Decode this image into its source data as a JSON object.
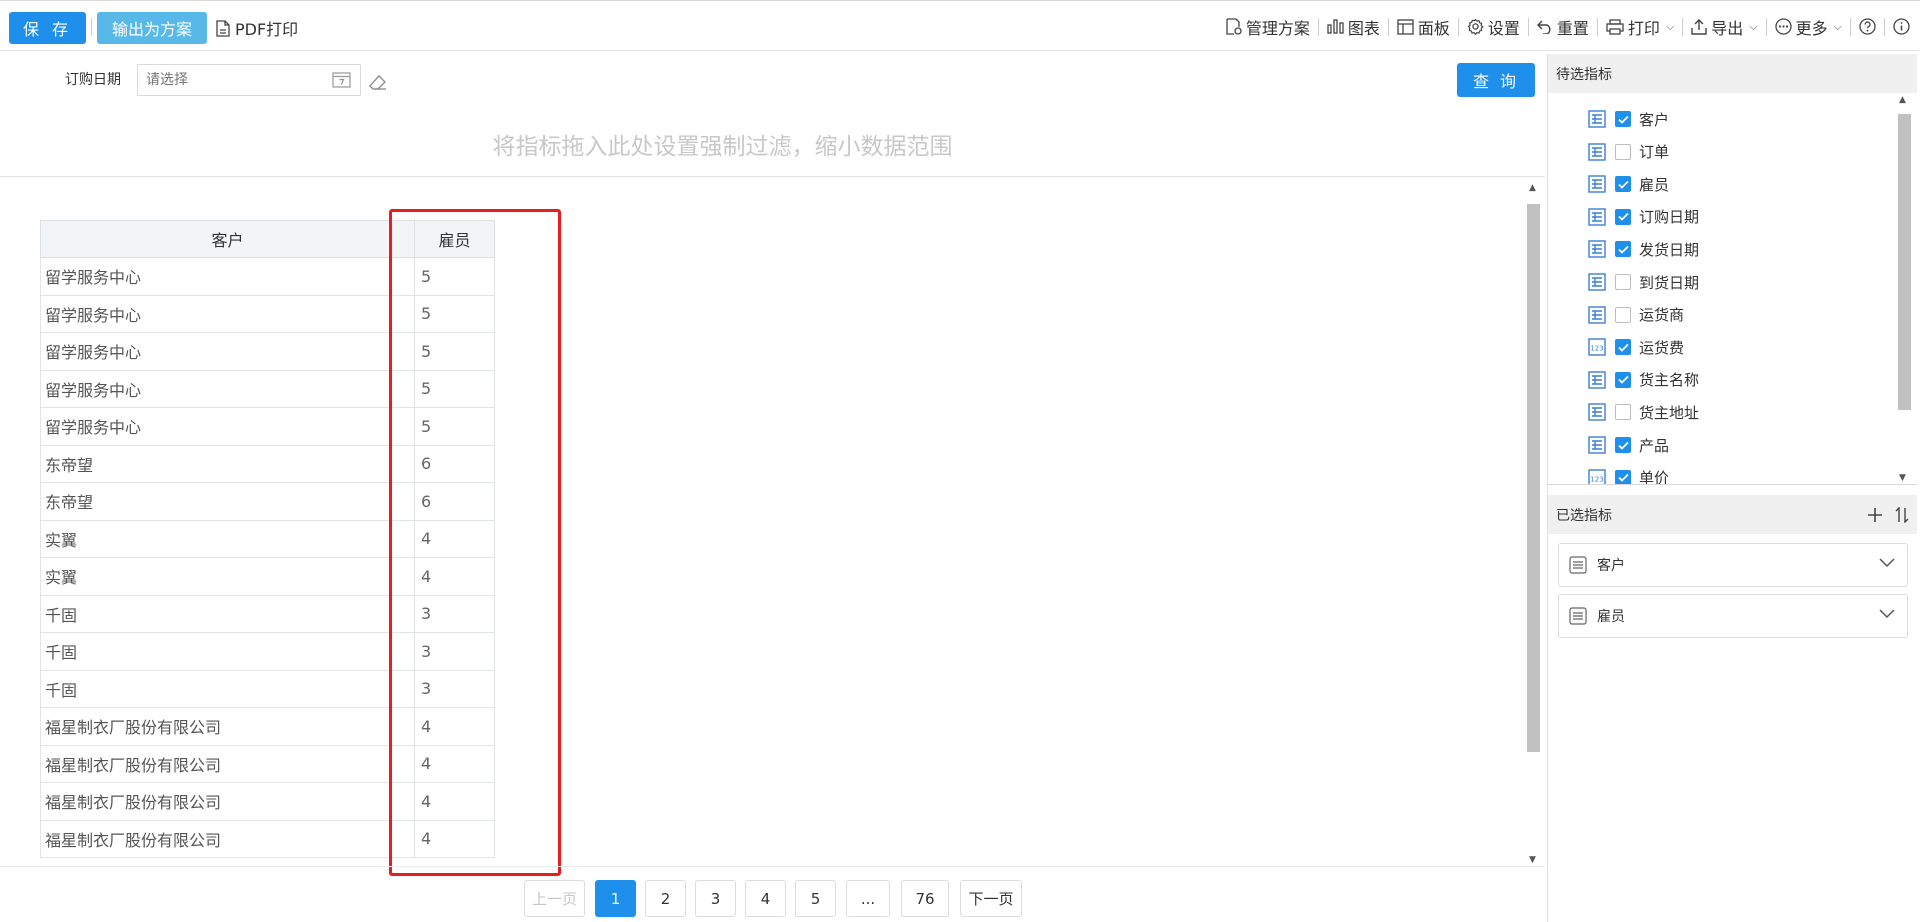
{
  "toolbar": {
    "save_label": "保 存",
    "export_plan_label": "输出为方案",
    "pdf_print_label": "PDF打印",
    "right_items": [
      {
        "label": "管理方案",
        "icon": "manage-plan-icon"
      },
      {
        "label": "图表",
        "icon": "chart-icon"
      },
      {
        "label": "面板",
        "icon": "panel-icon"
      },
      {
        "label": "设置",
        "icon": "gear-icon"
      },
      {
        "label": "重置",
        "icon": "reset-icon"
      },
      {
        "label": "打印",
        "icon": "printer-icon"
      },
      {
        "label": "导出",
        "icon": "export-icon"
      },
      {
        "label": "更多",
        "icon": "more-icon"
      }
    ]
  },
  "filter": {
    "date_label": "订购日期",
    "date_placeholder": "请选择",
    "query_label": "查 询",
    "drop_hint": "将指标拖入此处设置强制过滤，缩小数据范围"
  },
  "table": {
    "columns": [
      "客户",
      "雇员"
    ],
    "rows": [
      [
        "留学服务中心",
        "5"
      ],
      [
        "留学服务中心",
        "5"
      ],
      [
        "留学服务中心",
        "5"
      ],
      [
        "留学服务中心",
        "5"
      ],
      [
        "留学服务中心",
        "5"
      ],
      [
        "东帝望",
        "6"
      ],
      [
        "东帝望",
        "6"
      ],
      [
        "实翼",
        "4"
      ],
      [
        "实翼",
        "4"
      ],
      [
        "千固",
        "3"
      ],
      [
        "千固",
        "3"
      ],
      [
        "千固",
        "3"
      ],
      [
        "福星制衣厂股份有限公司",
        "4"
      ],
      [
        "福星制衣厂股份有限公司",
        "4"
      ],
      [
        "福星制衣厂股份有限公司",
        "4"
      ],
      [
        "福星制衣厂股份有限公司",
        "4"
      ]
    ]
  },
  "pagination": {
    "prev_label": "上一页",
    "pages": [
      "1",
      "2",
      "3",
      "4",
      "5",
      "...",
      "76"
    ],
    "active_page": "1",
    "next_label": "下一页"
  },
  "candidate_panel": {
    "title": "待选指标",
    "fields": [
      {
        "label": "客户",
        "type": "text",
        "checked": true
      },
      {
        "label": "订单",
        "type": "text",
        "checked": false
      },
      {
        "label": "雇员",
        "type": "text",
        "checked": true
      },
      {
        "label": "订购日期",
        "type": "text",
        "checked": true
      },
      {
        "label": "发货日期",
        "type": "text",
        "checked": true
      },
      {
        "label": "到货日期",
        "type": "text",
        "checked": false
      },
      {
        "label": "运货商",
        "type": "text",
        "checked": false
      },
      {
        "label": "运货费",
        "type": "number",
        "checked": true
      },
      {
        "label": "货主名称",
        "type": "text",
        "checked": true
      },
      {
        "label": "货主地址",
        "type": "text",
        "checked": false
      },
      {
        "label": "产品",
        "type": "text",
        "checked": true
      },
      {
        "label": "单价",
        "type": "number",
        "checked": true
      }
    ]
  },
  "selected_panel": {
    "title": "已选指标",
    "items": [
      "客户",
      "雇员"
    ]
  },
  "colors": {
    "primary": "#1e8fea",
    "secondary": "#58b8e8",
    "highlight": "#e81d1d"
  }
}
